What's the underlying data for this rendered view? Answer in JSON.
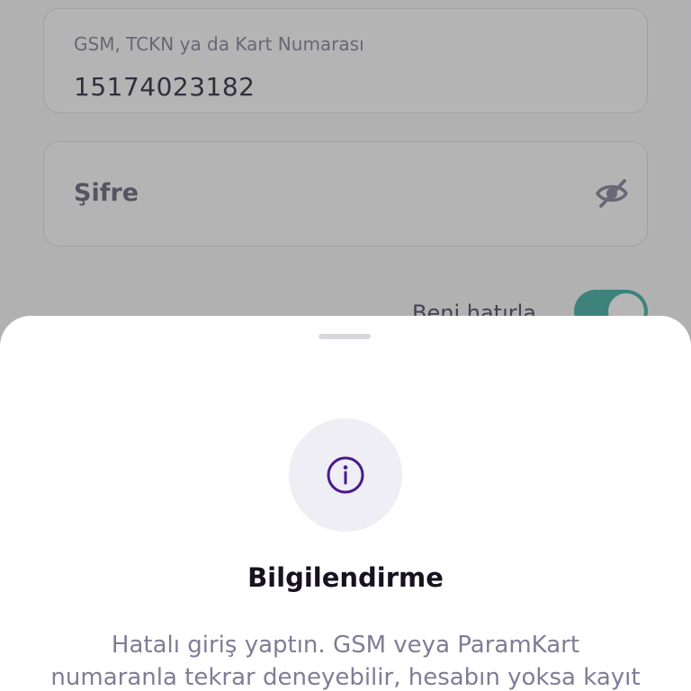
{
  "login_form": {
    "gsm_field": {
      "label": "GSM, TCKN ya da Kart Numarası",
      "value": "15174023182"
    },
    "password_field": {
      "placeholder": "Şifre",
      "visibility_icon": "eye-off-icon"
    },
    "remember_me": {
      "label": "Beni hatırla",
      "enabled": true
    }
  },
  "info_sheet": {
    "icon": "info-icon",
    "title": "Bilgilendirme",
    "message_line1": "Hatalı giriş yaptın. GSM veya ParamKart",
    "message_line2": "numaranla tekrar deneyebilir, hesabın yoksa kayıt"
  },
  "colors": {
    "accent_purple": "#4a1a8c",
    "toggle_teal": "#2fa79b",
    "overlay": "#505052"
  }
}
